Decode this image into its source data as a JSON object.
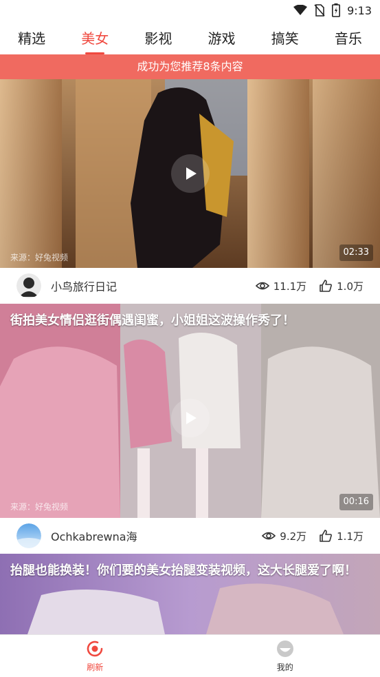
{
  "status_bar": {
    "time": "9:13"
  },
  "tabs": [
    {
      "label": "精选"
    },
    {
      "label": "美女"
    },
    {
      "label": "影视"
    },
    {
      "label": "游戏"
    },
    {
      "label": "搞笑"
    },
    {
      "label": "音乐"
    }
  ],
  "active_tab": "美女",
  "toast": "成功为您推荐8条内容",
  "feed": [
    {
      "title": "",
      "source": "来源：好兔视频",
      "duration": "02:33",
      "author": "小鸟旅行日记",
      "views": "11.1万",
      "likes": "1.0万"
    },
    {
      "title": "街拍美女情侣逛街偶遇闺蜜，小姐姐这波操作秀了！",
      "source": "来源：好兔视频",
      "duration": "00:16",
      "author": "Ochkabrewna海",
      "views": "9.2万",
      "likes": "1.1万"
    },
    {
      "title": "抬腿也能换装！你们要的美女抬腿变装视频，这大长腿爱了啊！"
    }
  ],
  "bottom_nav": {
    "refresh_label": "刷新",
    "mine_label": "我的"
  },
  "colors": {
    "accent": "#f0493f",
    "toast_bg": "#f06a60"
  }
}
